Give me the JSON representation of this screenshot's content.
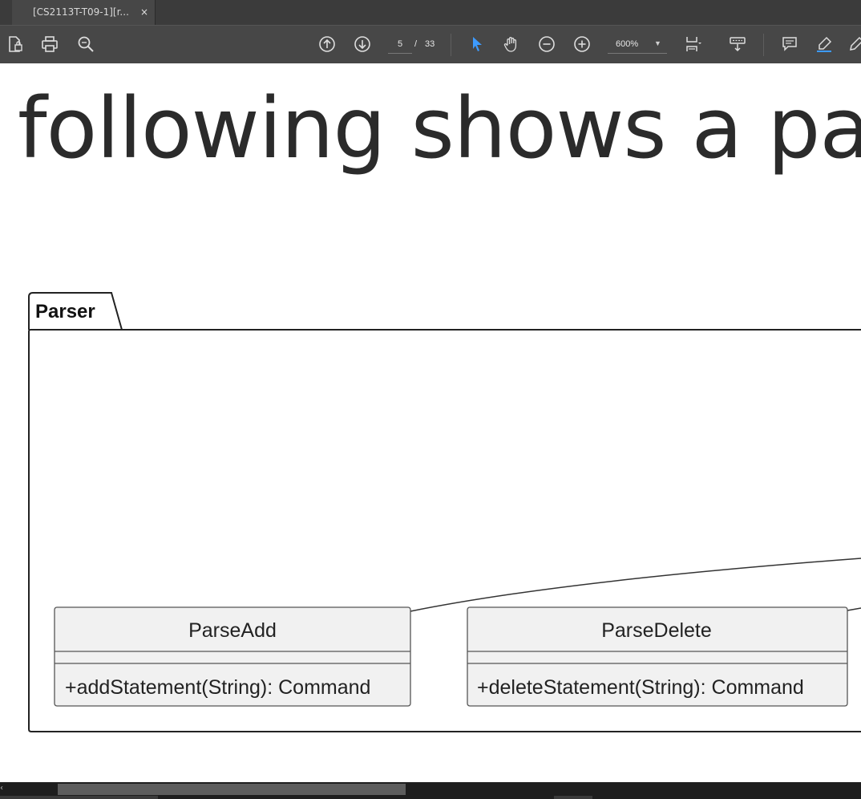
{
  "tab": {
    "title": "[CS2113T-T09-1][r...",
    "close": "×"
  },
  "toolbar": {
    "icons": [
      "file-lock-icon",
      "print-icon",
      "zoom-search-icon",
      "page-up-icon",
      "page-down-icon",
      "select-arrow-icon",
      "hand-icon",
      "zoom-out-icon",
      "zoom-in-icon",
      "fit-page-icon",
      "scroll-mode-icon",
      "comment-icon",
      "highlight-icon",
      "draw-icon"
    ],
    "current_page": "5",
    "page_separator": "/",
    "total_pages": "33",
    "zoom": "600%",
    "accent": "#3d9bff"
  },
  "document": {
    "heading": "following shows a par",
    "diagram": {
      "package_name": "Parser",
      "classes": [
        {
          "name": "ParseAdd",
          "method": "+addStatement(String): Command"
        },
        {
          "name": "ParseDelete",
          "method": "+deleteStatement(String): Command"
        }
      ]
    }
  }
}
